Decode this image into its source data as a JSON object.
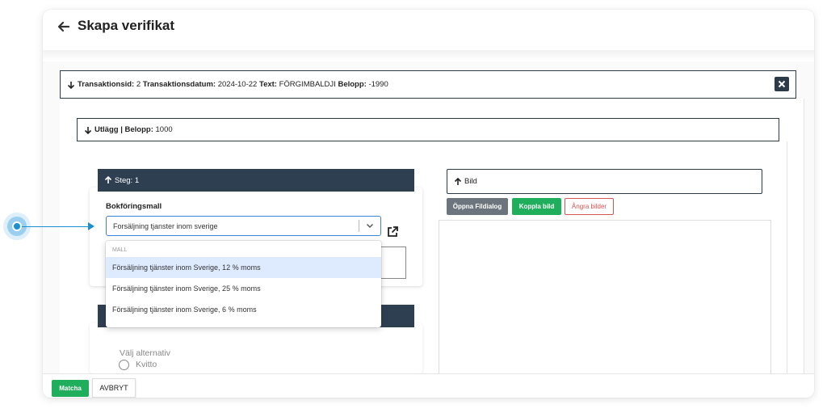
{
  "header": {
    "title": "Skapa verifikat"
  },
  "transaction": {
    "id_label": "Transaktionsid:",
    "id_value": "2",
    "date_label": "Transaktionsdatum:",
    "date_value": "2024-10-22",
    "text_label": "Text:",
    "text_value": "FÖRGIMBALDJI",
    "amount_label": "Belopp:",
    "amount_value": "-1990"
  },
  "utlagg": {
    "label": "Utlägg",
    "separator": "|",
    "amount_label": "Belopp:",
    "amount_value": "1000"
  },
  "step": {
    "label": "Steg: 1",
    "field_label": "Bokföringsmall",
    "selected_value": "Forsäljning tjanster inom sverige"
  },
  "dropdown": {
    "group_label": "MALL",
    "options": [
      "Försäljning tjänster inom Sverige, 12 % moms",
      "Försäljning tjänster inom Sverige, 25 % moms",
      "Försäljning tjänster inom Sverige, 6 % moms"
    ],
    "highlighted_index": 0
  },
  "step2": {
    "radio_group_label": "Välj alternativ",
    "radio_option": "Kvitto"
  },
  "bild": {
    "label": "Bild",
    "buttons": {
      "open_dialog": "Öppna Fildialog",
      "link_image": "Koppla bild",
      "undo_images": "Ångra bilder"
    }
  },
  "footer": {
    "match_label": "Matcha",
    "cancel_label": "AVBRYT"
  },
  "colors": {
    "dark_navy": "#2f3f52",
    "green": "#1fae5c",
    "grey_button": "#6c757d",
    "danger": "#d9534f",
    "focus_blue": "#3b82d6",
    "highlight": "#deebff",
    "pointer": "#1a8fd1"
  },
  "icons": {
    "back": "arrow-left-icon",
    "close": "close-icon",
    "collapse": "arrow-down-icon",
    "expand": "arrow-up-icon",
    "chevron": "chevron-down-icon",
    "external": "external-link-icon"
  }
}
